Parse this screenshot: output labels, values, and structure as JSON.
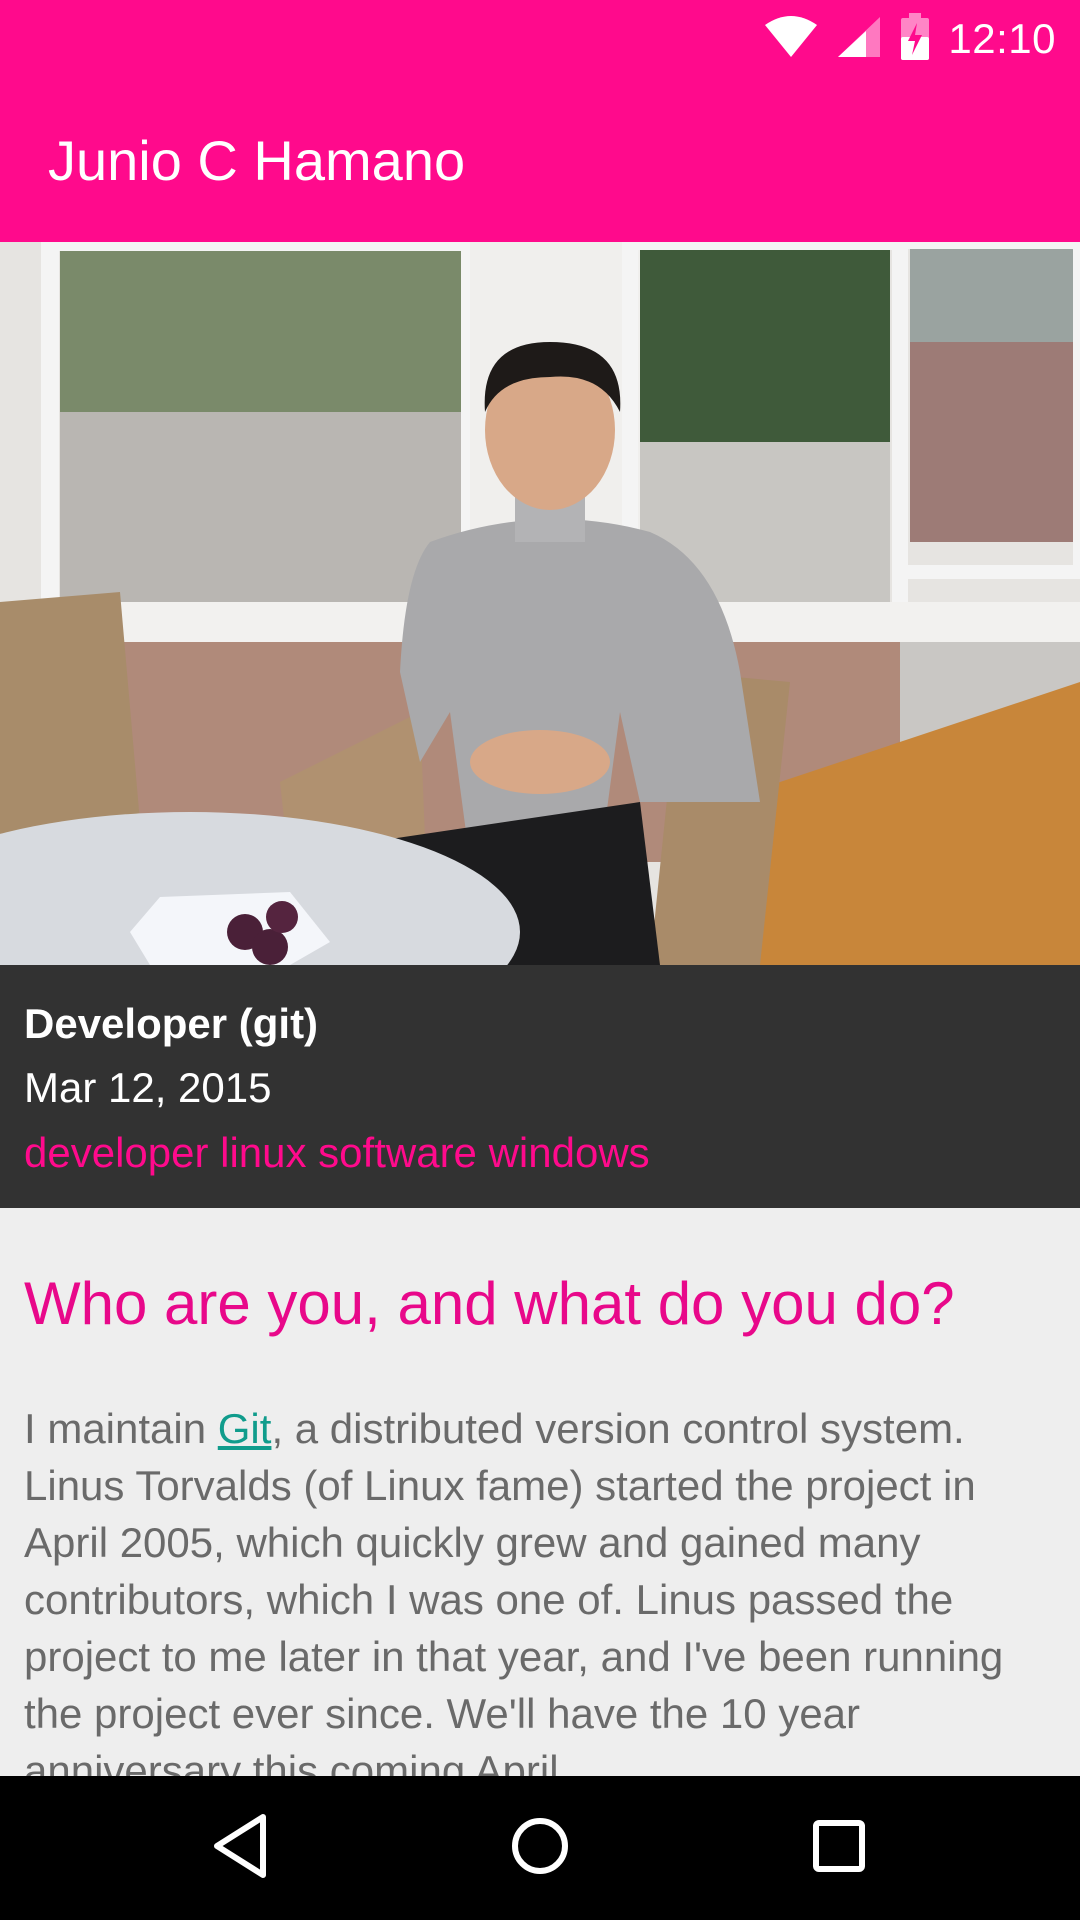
{
  "status_bar": {
    "time": "12:10",
    "icons": [
      "wifi-icon",
      "cell-signal-icon",
      "battery-charging-icon"
    ]
  },
  "app_bar": {
    "title": "Junio C Hamano"
  },
  "hero": {
    "image": "portrait-photo"
  },
  "meta": {
    "role": "Developer (git)",
    "date": "Mar 12, 2015",
    "tags": "developer linux software windows"
  },
  "content": {
    "question": "Who are you, and what do you do?",
    "answer_prefix": "I maintain ",
    "answer_link": "Git",
    "answer_rest": ", a distributed version control system. Linus Torvalds (of Linux fame) started the project in April 2005, which quickly grew and gained many contributors, which I was one of. Linus passed the project to me later in that year, and I've been running the project ever since. We'll have the 10 year anniversary this coming April."
  },
  "nav_bar": {
    "buttons": [
      "back-icon",
      "home-icon",
      "recents-icon"
    ]
  },
  "colors": {
    "accent": "#ff0a8c",
    "meta_background": "#323232",
    "link": "#109c8c"
  }
}
